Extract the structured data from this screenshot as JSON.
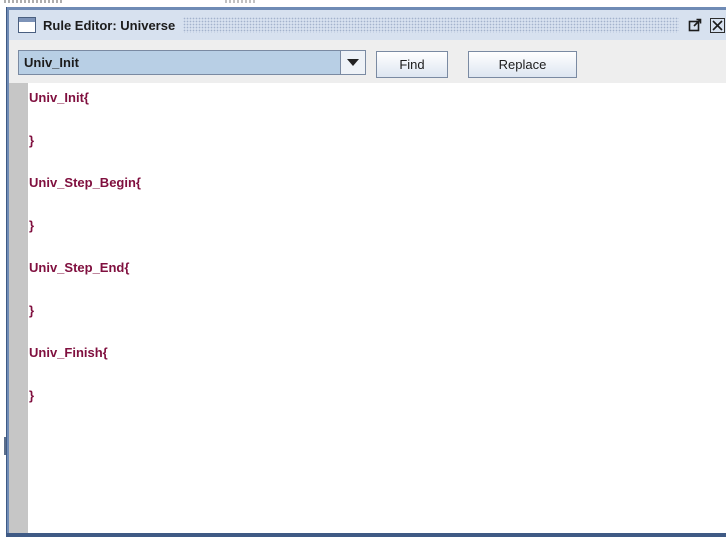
{
  "window": {
    "title": "Rule Editor: Universe",
    "maximize_icon": "external-maximize-icon",
    "close_icon": "close-icon"
  },
  "toolbar": {
    "rule_select_value": "Univ_Init",
    "find_label": "Find",
    "replace_label": "Replace"
  },
  "editor": {
    "lines": [
      "Univ_Init{",
      "}",
      "Univ_Step_Begin{",
      "}",
      "Univ_Step_End{",
      "}",
      "Univ_Finish{",
      "}"
    ]
  },
  "colors": {
    "keyword": "#80103f",
    "titlebar": "#d7e1ef",
    "frame": "#6f8bb5",
    "selection": "#b8cfe5"
  }
}
